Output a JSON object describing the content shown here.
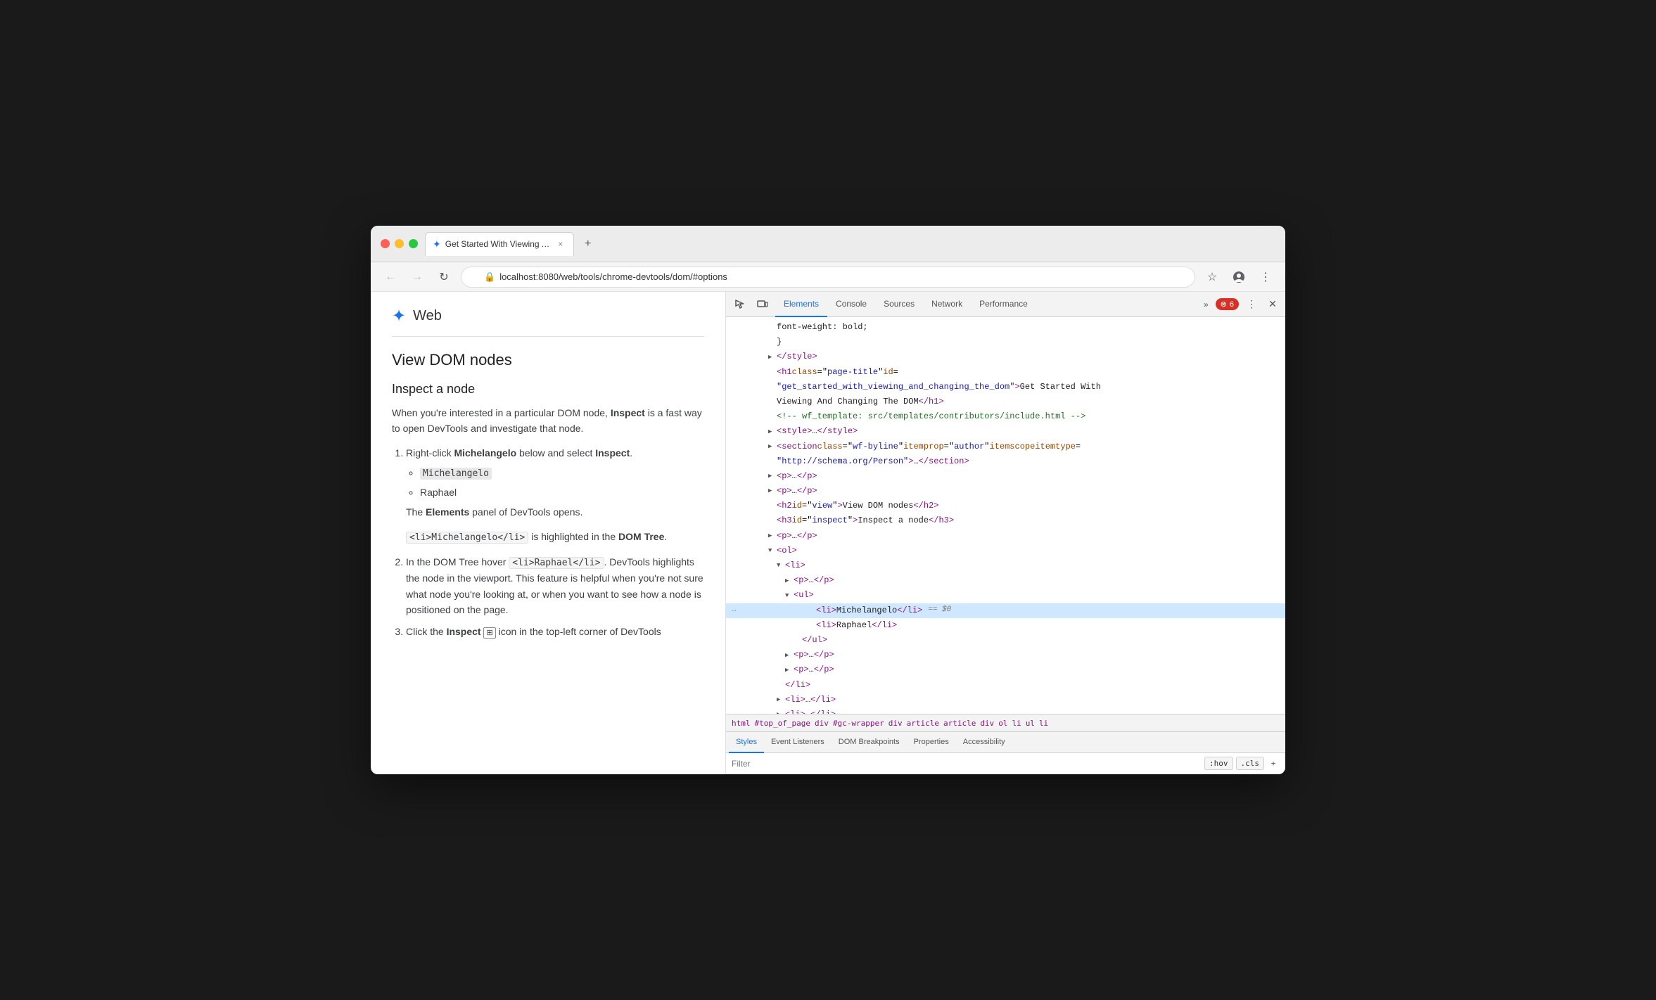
{
  "browser": {
    "traffic_lights": [
      "red",
      "yellow",
      "green"
    ],
    "tab": {
      "favicon": "✦",
      "title": "Get Started With Viewing And",
      "close": "×"
    },
    "new_tab_icon": "+",
    "address_bar": {
      "url": "localhost:8080/web/tools/chrome-devtools/dom/#options",
      "lock_icon": "🔒"
    },
    "nav": {
      "back": "←",
      "forward": "→",
      "refresh": "↻"
    }
  },
  "page": {
    "logo": "✦",
    "site_name": "Web",
    "heading_h2": "View DOM nodes",
    "heading_h3": "Inspect a node",
    "paragraph1": "When you're interested in a particular DOM node, ",
    "paragraph1_bold": "Inspect",
    "paragraph1_rest": " is a fast way to open DevTools and investigate that node.",
    "list_item1_pre": "Right-click ",
    "list_item1_bold1": "Michelangelo",
    "list_item1_mid": " below and select ",
    "list_item1_bold2": "Inspect",
    "list_item1_end": ".",
    "michelangelo_label": "Michelangelo",
    "raphael_label": "Raphael",
    "elements_note_pre": "The ",
    "elements_note_bold": "Elements",
    "elements_note_rest": " panel of DevTools opens.",
    "code_snippet": "<li>Michelangelo</li>",
    "code_note_pre": " is highlighted in the ",
    "code_note_bold": "DOM Tree",
    "code_note_end": ".",
    "list_item2_pre": "In the DOM Tree hover ",
    "list_item2_code": "<li>Raphael</li>",
    "list_item2_rest": ". DevTools highlights the node in the viewport. This feature is helpful when you're not sure what node you're looking at, or when you want to see how a node is positioned on the page.",
    "list_item3_pre": "Click the ",
    "list_item3_bold": "Inspect",
    "list_item3_icon": "⊞",
    "list_item3_rest": " icon in the top-left corner of DevTools"
  },
  "devtools": {
    "toolbar_icons": [
      "cursor-icon",
      "box-icon"
    ],
    "tabs": [
      {
        "label": "Elements",
        "active": true
      },
      {
        "label": "Console",
        "active": false
      },
      {
        "label": "Sources",
        "active": false
      },
      {
        "label": "Network",
        "active": false
      },
      {
        "label": "Performance",
        "active": false
      }
    ],
    "more_icon": "»",
    "error_badge": "⊗ 6",
    "menu_icon": "⋮",
    "close_icon": "×",
    "dom_lines": [
      {
        "indent": 4,
        "arrow": "none",
        "content": "font-weight: bold;",
        "type": "text",
        "highlighted": false
      },
      {
        "indent": 4,
        "arrow": "none",
        "content": "}",
        "type": "text",
        "highlighted": false
      },
      {
        "indent": 3,
        "arrow": "collapsed",
        "content": "</style>",
        "type": "tag",
        "highlighted": false
      },
      {
        "indent": 3,
        "arrow": "none",
        "content": "<h1 class=\"page-title\" id=",
        "type": "tag",
        "highlighted": false
      },
      {
        "indent": 3,
        "arrow": "none",
        "content": "\"get_started_with_viewing_and_changing_the_dom\">Get Started With",
        "type": "attr",
        "highlighted": false
      },
      {
        "indent": 3,
        "arrow": "none",
        "content": "Viewing And Changing The DOM</h1>",
        "type": "text",
        "highlighted": false
      },
      {
        "indent": 3,
        "arrow": "none",
        "content": "<!-- wf_template: src/templates/contributors/include.html -->",
        "type": "comment",
        "highlighted": false
      },
      {
        "indent": 3,
        "arrow": "collapsed",
        "content": "<style>…</style>",
        "type": "tag",
        "highlighted": false
      },
      {
        "indent": 3,
        "arrow": "collapsed",
        "content": "<section class=\"wf-byline\" itemprop=\"author\" itemscope itemtype=",
        "type": "tag",
        "highlighted": false
      },
      {
        "indent": 3,
        "arrow": "none",
        "content": "\"http://schema.org/Person\">…</section>",
        "type": "attr",
        "highlighted": false
      },
      {
        "indent": 3,
        "arrow": "collapsed",
        "content": "<p>…</p>",
        "type": "tag",
        "highlighted": false
      },
      {
        "indent": 3,
        "arrow": "collapsed",
        "content": "<p>…</p>",
        "type": "tag",
        "highlighted": false
      },
      {
        "indent": 3,
        "arrow": "none",
        "content": "<h2 id=\"view\">View DOM nodes</h2>",
        "type": "tag",
        "highlighted": false
      },
      {
        "indent": 3,
        "arrow": "none",
        "content": "<h3 id=\"inspect\">Inspect a node</h3>",
        "type": "tag",
        "highlighted": false
      },
      {
        "indent": 3,
        "arrow": "collapsed",
        "content": "<p>…</p>",
        "type": "tag",
        "highlighted": false
      },
      {
        "indent": 3,
        "arrow": "expanded",
        "content": "<ol>",
        "type": "tag",
        "highlighted": false
      },
      {
        "indent": 4,
        "arrow": "expanded",
        "content": "<li>",
        "type": "tag",
        "highlighted": false
      },
      {
        "indent": 5,
        "arrow": "collapsed",
        "content": "<p>…</p>",
        "type": "tag",
        "highlighted": false
      },
      {
        "indent": 5,
        "arrow": "expanded",
        "content": "<ul>",
        "type": "tag",
        "highlighted": false
      },
      {
        "indent": 7,
        "arrow": "none",
        "content": "<li>Michelangelo</li> == $0",
        "type": "highlighted_line",
        "highlighted": true
      },
      {
        "indent": 8,
        "arrow": "none",
        "content": "<li>Raphael</li>",
        "type": "tag",
        "highlighted": false
      },
      {
        "indent": 6,
        "arrow": "none",
        "content": "</ul>",
        "type": "tag",
        "highlighted": false
      },
      {
        "indent": 5,
        "arrow": "collapsed",
        "content": "<p>…</p>",
        "type": "tag",
        "highlighted": false
      },
      {
        "indent": 5,
        "arrow": "collapsed",
        "content": "<p>…</p>",
        "type": "tag",
        "highlighted": false
      },
      {
        "indent": 4,
        "arrow": "none",
        "content": "</li>",
        "type": "tag",
        "highlighted": false
      },
      {
        "indent": 4,
        "arrow": "collapsed",
        "content": "<li>…</li>",
        "type": "tag",
        "highlighted": false
      },
      {
        "indent": 4,
        "arrow": "collapsed",
        "content": "<li>…</li>",
        "type": "tag",
        "highlighted": false
      }
    ],
    "breadcrumb": [
      "html",
      "#top_of_page",
      "div",
      "#gc-wrapper",
      "div",
      "article",
      "article",
      "div",
      "ol",
      "li",
      "ul",
      "li"
    ],
    "panel_tabs": [
      "Styles",
      "Event Listeners",
      "DOM Breakpoints",
      "Properties",
      "Accessibility"
    ],
    "active_panel_tab": "Styles",
    "filter": {
      "placeholder": "Filter",
      "hov_btn": ":hov",
      "cls_btn": ".cls",
      "plus_icon": "+"
    }
  }
}
